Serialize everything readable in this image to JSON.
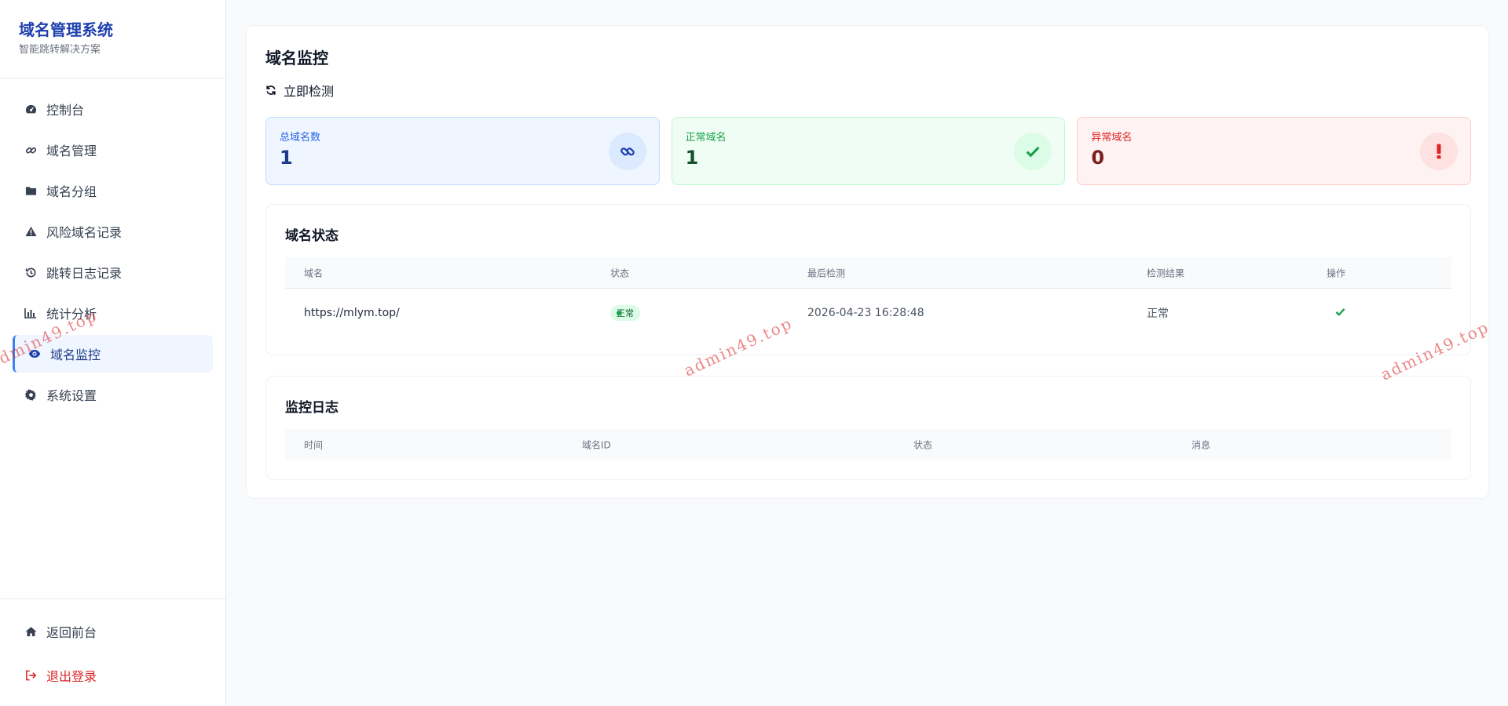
{
  "brand": {
    "title": "域名管理系统",
    "subtitle": "智能跳转解决方案"
  },
  "nav": {
    "items": [
      {
        "label": "控制台",
        "icon": "dashboard-icon"
      },
      {
        "label": "域名管理",
        "icon": "link-icon"
      },
      {
        "label": "域名分组",
        "icon": "folder-icon"
      },
      {
        "label": "风险域名记录",
        "icon": "warning-icon"
      },
      {
        "label": "跳转日志记录",
        "icon": "history-icon"
      },
      {
        "label": "统计分析",
        "icon": "bar-chart-icon"
      },
      {
        "label": "域名监控",
        "icon": "eye-icon",
        "active": true
      },
      {
        "label": "系统设置",
        "icon": "gear-icon"
      }
    ],
    "bottom": [
      {
        "label": "返回前台",
        "icon": "home-icon"
      },
      {
        "label": "退出登录",
        "icon": "sign-out-icon"
      }
    ]
  },
  "page": {
    "title": "域名监控",
    "refresh_label": "立即检测"
  },
  "stats": [
    {
      "label": "总域名数",
      "value": "1",
      "icon": "link-icon",
      "color": "#2563eb"
    },
    {
      "label": "正常域名",
      "value": "1",
      "icon": "check-icon",
      "color": "#16a34a"
    },
    {
      "label": "异常域名",
      "value": "0",
      "icon": "exclamation-icon",
      "color": "#dc2626"
    }
  ],
  "status_table": {
    "title": "域名状态",
    "columns": [
      "域名",
      "状态",
      "最后检测",
      "检测结果",
      "操作"
    ],
    "rows": [
      {
        "domain": "https://mlym.top/",
        "status": "正常",
        "last_check": "2026-04-23 16:28:48",
        "result": "正常",
        "action_icon": "check-icon"
      }
    ]
  },
  "log_table": {
    "title": "监控日志",
    "columns": [
      "时间",
      "域名ID",
      "状态",
      "消息"
    ],
    "rows": []
  },
  "watermark": "admin49.top"
}
